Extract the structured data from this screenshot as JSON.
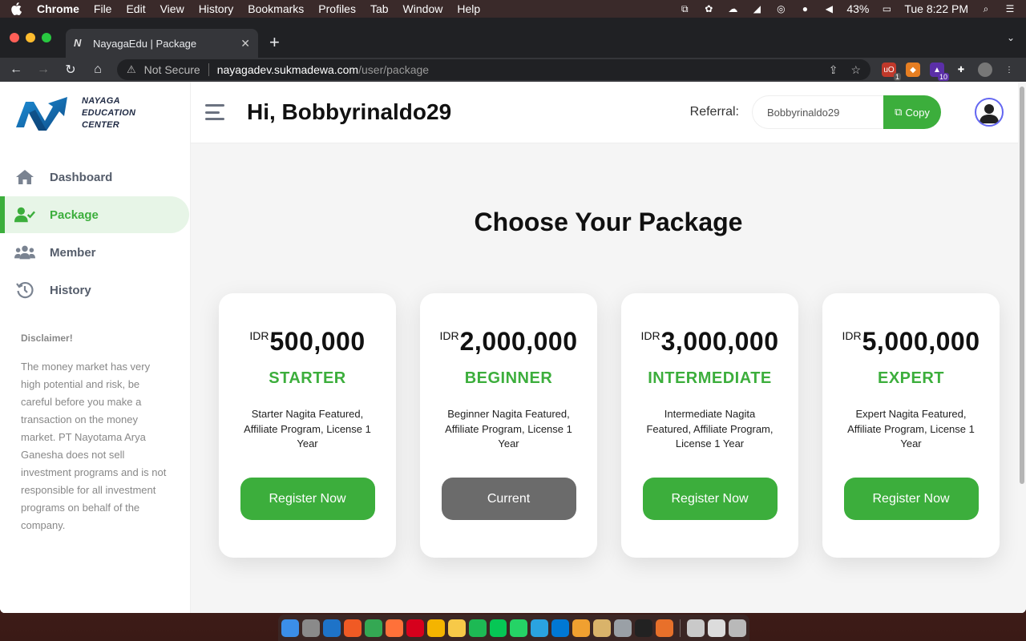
{
  "menubar": {
    "app_name": "Chrome",
    "items": [
      "File",
      "Edit",
      "View",
      "History",
      "Bookmarks",
      "Profiles",
      "Tab",
      "Window",
      "Help"
    ],
    "battery": "43%",
    "clock": "Tue 8:22 PM"
  },
  "browser": {
    "tab_title": "NayagaEdu | Package",
    "not_secure": "Not Secure",
    "url_domain": "nayagadev.sukmadewa.com",
    "url_path": "/user/package",
    "ext_badges": [
      "1",
      "10"
    ]
  },
  "sidebar": {
    "logo_lines": [
      "NAYAGA",
      "EDUCATION",
      "CENTER"
    ],
    "items": [
      {
        "label": "Dashboard",
        "icon": "home-icon"
      },
      {
        "label": "Package",
        "icon": "user-check-icon"
      },
      {
        "label": "Member",
        "icon": "users-icon"
      },
      {
        "label": "History",
        "icon": "history-icon"
      }
    ],
    "disclaimer_title": "Disclaimer!",
    "disclaimer_text": "The money market has very high potential and risk, be careful before you make a transaction on the money market. PT Nayotama Arya Ganesha does not sell investment programs and is not responsible for all investment programs on behalf of the company."
  },
  "header": {
    "greeting": "Hi, Bobbyrinaldo29",
    "referral_label": "Referral:",
    "referral_value": "Bobbyrinaldo29",
    "copy_label": "Copy"
  },
  "main": {
    "title": "Choose Your Package",
    "packages": [
      {
        "currency": "IDR",
        "amount": "500,000",
        "tier": "STARTER",
        "description": "Starter Nagita Featured, Affiliate Program, License 1 Year",
        "button": "Register Now"
      },
      {
        "currency": "IDR",
        "amount": "2,000,000",
        "tier": "BEGINNER",
        "description": "Beginner Nagita Featured, Affiliate Program, License 1 Year",
        "button": "Current"
      },
      {
        "currency": "IDR",
        "amount": "3,000,000",
        "tier": "INTERMEDIATE",
        "description": "Intermediate Nagita Featured, Affiliate Program, License 1 Year",
        "button": "Register Now"
      },
      {
        "currency": "IDR",
        "amount": "5,000,000",
        "tier": "EXPERT",
        "description": "Expert Nagita Featured, Affiliate Program, License 1 Year",
        "button": "Register Now"
      }
    ]
  },
  "colors": {
    "accent_green": "#3cae3c",
    "current_gray": "#6b6b6b",
    "logo_blue": "#1d8fd8"
  }
}
